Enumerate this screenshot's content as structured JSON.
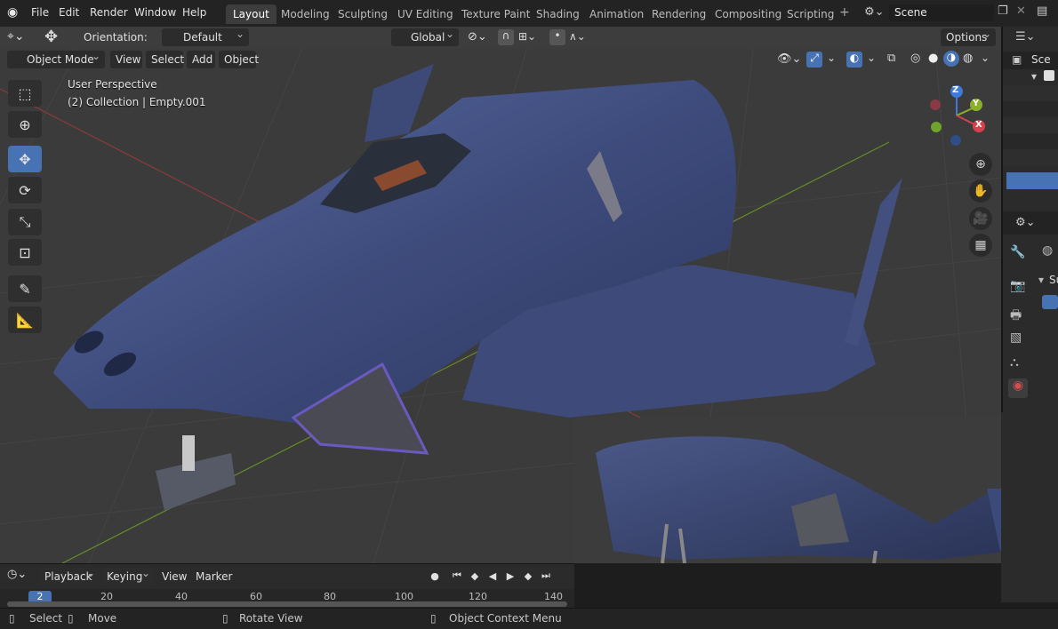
{
  "menu": [
    "File",
    "Edit",
    "Render",
    "Window",
    "Help"
  ],
  "workspaces": [
    {
      "label": "Layout",
      "active": true
    },
    {
      "label": "Modeling",
      "active": false
    },
    {
      "label": "Sculpting",
      "active": false
    },
    {
      "label": "UV Editing",
      "active": false
    },
    {
      "label": "Texture Paint",
      "active": false
    },
    {
      "label": "Shading",
      "active": false
    },
    {
      "label": "Animation",
      "active": false
    },
    {
      "label": "Rendering",
      "active": false
    },
    {
      "label": "Compositing",
      "active": false
    },
    {
      "label": "Scripting",
      "active": false
    }
  ],
  "scene": {
    "name": "Scene"
  },
  "header": {
    "orientation_label": "Orientation:",
    "orientation_value": "Default",
    "transform_space": "Global",
    "options_label": "Options"
  },
  "viewport_header": {
    "mode": "Object Mode",
    "menus": [
      "View",
      "Select",
      "Add",
      "Object"
    ]
  },
  "overlay": {
    "perspective": "User Perspective",
    "collection": "(2) Collection | Empty.001"
  },
  "gizmo": {
    "x": "X",
    "y": "Y",
    "z": "Z"
  },
  "outliner": {
    "scene_truncated": "Sce"
  },
  "properties": {
    "section_truncated": "Su"
  },
  "timeline": {
    "menus": [
      "Playback",
      "Keying",
      "View",
      "Marker"
    ],
    "current_frame": "2",
    "ticks": [
      "20",
      "40",
      "60",
      "80",
      "100",
      "120",
      "140"
    ]
  },
  "statusbar": {
    "select": "Select",
    "move": "Move",
    "rotate": "Rotate View",
    "context": "Object Context Menu"
  },
  "colors": {
    "accent": "#4772b3",
    "ship": "#3f4d7c",
    "bg": "#3a3a3a"
  }
}
